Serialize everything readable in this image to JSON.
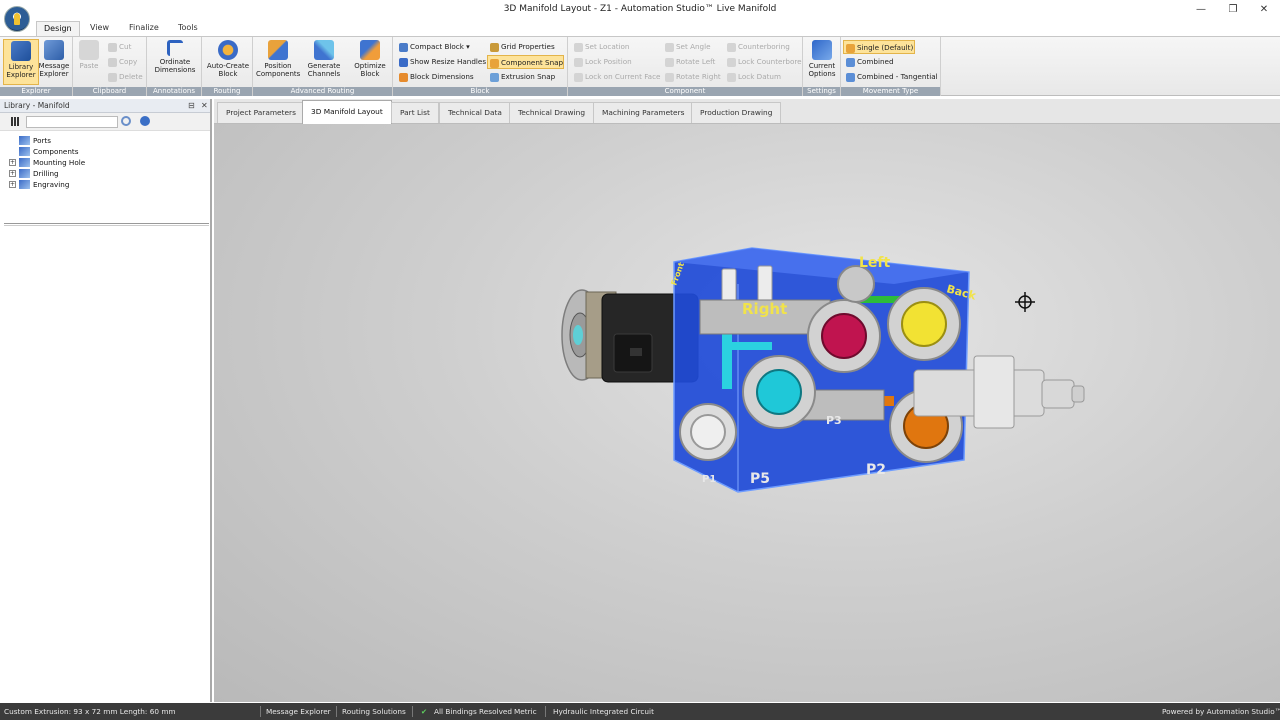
{
  "window": {
    "title": "3D Manifold Layout - Z1 - Automation Studio™ Live Manifold",
    "minimize_glyph": "—",
    "restore_glyph": "❐",
    "close_glyph": "✕"
  },
  "menu_tabs": [
    "Design",
    "View",
    "Finalize",
    "Tools"
  ],
  "ribbon": {
    "explorer": {
      "label": "Explorer",
      "library_explorer": "Library Explorer",
      "message_explorer": "Message Explorer"
    },
    "clipboard": {
      "label": "Clipboard",
      "paste": "Paste",
      "cut": "Cut",
      "copy": "Copy",
      "delete": "Delete"
    },
    "annotations": {
      "label": "Annotations",
      "ordinate_dimensions": "Ordinate Dimensions"
    },
    "routing": {
      "label": "Routing",
      "auto_create_block": "Auto-Create Block"
    },
    "advanced_routing": {
      "label": "Advanced Routing",
      "position_components": "Position Components",
      "generate_channels": "Generate Channels",
      "optimize_block": "Optimize Block"
    },
    "block": {
      "label": "Block",
      "compact_block": "Compact Block",
      "show_resize_handles": "Show Resize Handles",
      "block_dimensions": "Block Dimensions",
      "grid_properties": "Grid Properties",
      "component_snap": "Component Snap",
      "extrusion_snap": "Extrusion Snap"
    },
    "component": {
      "label": "Component",
      "set_location": "Set Location",
      "lock_position": "Lock Position",
      "lock_on_current_face": "Lock on Current Face",
      "set_angle": "Set Angle",
      "rotate_left": "Rotate Left",
      "rotate_right": "Rotate Right",
      "counterboring": "Counterboring",
      "lock_counterbore": "Lock Counterbore",
      "lock_datum": "Lock Datum"
    },
    "settings": {
      "label": "Settings",
      "current_options": "Current Options"
    },
    "movement_type": {
      "label": "Movement Type",
      "single_default": "Single (Default)",
      "combined": "Combined",
      "combined_tangential": "Combined - Tangential"
    }
  },
  "library": {
    "title": "Library - Manifold",
    "pin_glyph": "⊟",
    "close_glyph": "✕",
    "search_value": "",
    "tree": [
      {
        "label": "Ports",
        "expandable": false
      },
      {
        "label": "Components",
        "expandable": false
      },
      {
        "label": "Mounting Hole",
        "expandable": true
      },
      {
        "label": "Drilling",
        "expandable": true
      },
      {
        "label": "Engraving",
        "expandable": true
      }
    ]
  },
  "doc_tabs": [
    "Project Parameters",
    "3D Manifold Layout",
    "Part List",
    "Technical Data",
    "Technical Drawing",
    "Machining Parameters",
    "Production Drawing"
  ],
  "active_doc_tab": "3D Manifold Layout",
  "model_labels": {
    "left": "Left",
    "back": "Back",
    "right": "Right",
    "front": "Front",
    "p5": "P5",
    "p2": "P2",
    "p3": "P3",
    "p1": "P1"
  },
  "status": {
    "extrusion": "Custom Extrusion: 93 x 72 mm  Length: 60 mm",
    "message_explorer": "Message Explorer",
    "routing_solutions": "Routing Solutions",
    "bindings": "All Bindings Resolved",
    "units": "Metric",
    "circuit": "Hydraulic Integrated Circuit",
    "powered_by": "Powered by Automation Studio™"
  },
  "colors": {
    "block_blue": "#1f4bd8",
    "ribbon_label": "#9aa5b1",
    "active_yellow": "#fde39a",
    "status_bar": "#3b3b3b",
    "port_magenta": "#c0144f",
    "port_yellow": "#f2e233",
    "port_cyan": "#1fc8d8",
    "port_orange": "#e0760f",
    "channel_green": "#2dbb3a"
  }
}
